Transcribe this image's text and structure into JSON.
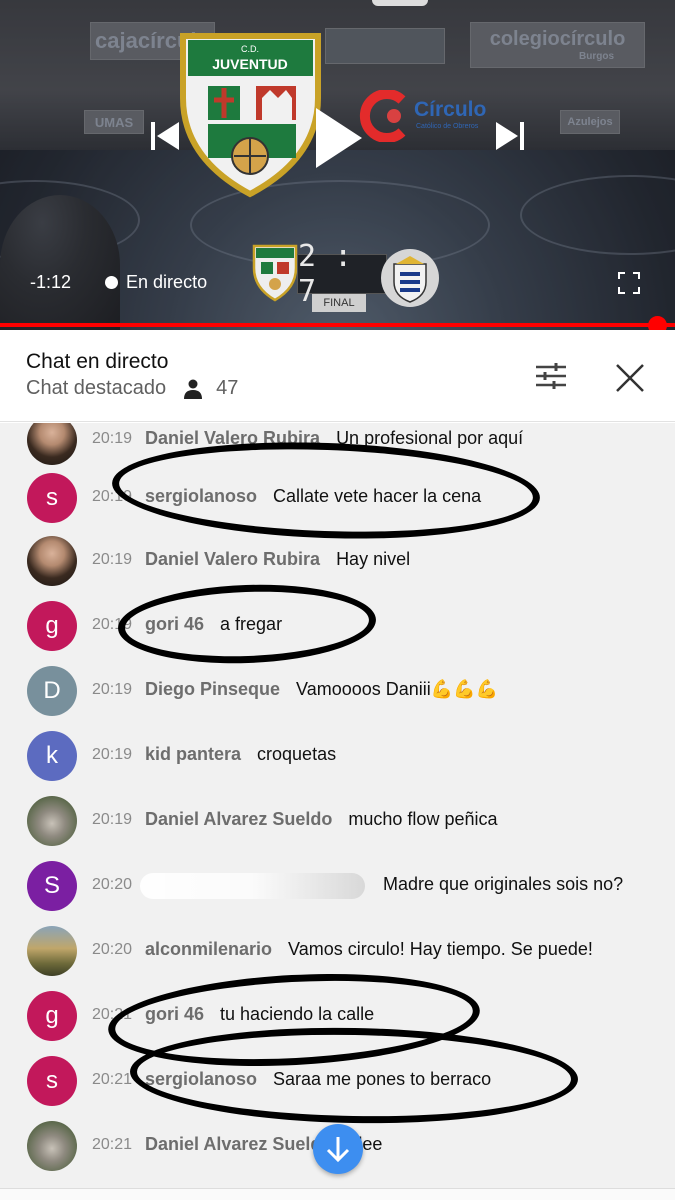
{
  "player": {
    "time_remaining": "-1:12",
    "live_label": "En directo",
    "banners": {
      "left": "cajacírculo",
      "right": "colegiocírculo",
      "right_sub": "Burgos",
      "center_brand": "Círculo",
      "center_brand_sub": "Católico de Obreros",
      "left_lower": "UMAS",
      "right_lower": "Azulejos"
    },
    "crest_label": "JUVENTUD",
    "crest_top": "C.D.",
    "scoreboard": {
      "score": "2 : 7",
      "status": "FINAL",
      "home_label": "JUVENTUD"
    },
    "progress": 1.0,
    "icons": [
      "previous-icon",
      "play-icon",
      "next-icon",
      "fullscreen-icon"
    ]
  },
  "chat": {
    "title": "Chat en directo",
    "mode": "Chat destacado",
    "viewers": "47",
    "icons": [
      "settings-icon",
      "close-icon",
      "person-icon"
    ]
  },
  "messages": [
    {
      "time": "20:19",
      "author": "Daniel Valero Rubira",
      "text": "Un profesional por aquí",
      "avatar": "photo",
      "avatar_letter": ""
    },
    {
      "time": "20:19",
      "author": "sergiolanoso",
      "text": "Callate vete hacer la cena",
      "avatar": "#c2185b",
      "avatar_letter": "s"
    },
    {
      "time": "20:19",
      "author": "Daniel Valero Rubira",
      "text": "Hay nivel",
      "avatar": "photo",
      "avatar_letter": ""
    },
    {
      "time": "20:19",
      "author": "gori 46",
      "text": "a fregar",
      "avatar": "#c2185b",
      "avatar_letter": "g"
    },
    {
      "time": "20:19",
      "author": "Diego Pinseque",
      "text": "Vamoooos Daniii💪💪💪",
      "avatar": "#78909c",
      "avatar_letter": "D"
    },
    {
      "time": "20:19",
      "author": "kid pantera",
      "text": "croquetas",
      "avatar": "#5c6bc0",
      "avatar_letter": "k"
    },
    {
      "time": "20:19",
      "author": "Daniel Alvarez Sueldo",
      "text": "mucho flow peñica",
      "avatar": "koala",
      "avatar_letter": ""
    },
    {
      "time": "20:20",
      "author": "",
      "text": "Madre que originales sois no?",
      "avatar": "#7b1fa2",
      "avatar_letter": "S"
    },
    {
      "time": "20:20",
      "author": "alconmilenario",
      "text": "Vamos circulo! Hay tiempo. Se puede!",
      "avatar": "scene",
      "avatar_letter": ""
    },
    {
      "time": "20:21",
      "author": "gori 46",
      "text": "tu haciendo la calle",
      "avatar": "#c2185b",
      "avatar_letter": "g"
    },
    {
      "time": "20:21",
      "author": "sergiolanoso",
      "text": "Saraa me pones to berraco",
      "avatar": "#c2185b",
      "avatar_letter": "s"
    },
    {
      "time": "20:21",
      "author": "Daniel Alvarez Sueldo",
      "text": "olee",
      "avatar": "koala",
      "avatar_letter": ""
    }
  ]
}
